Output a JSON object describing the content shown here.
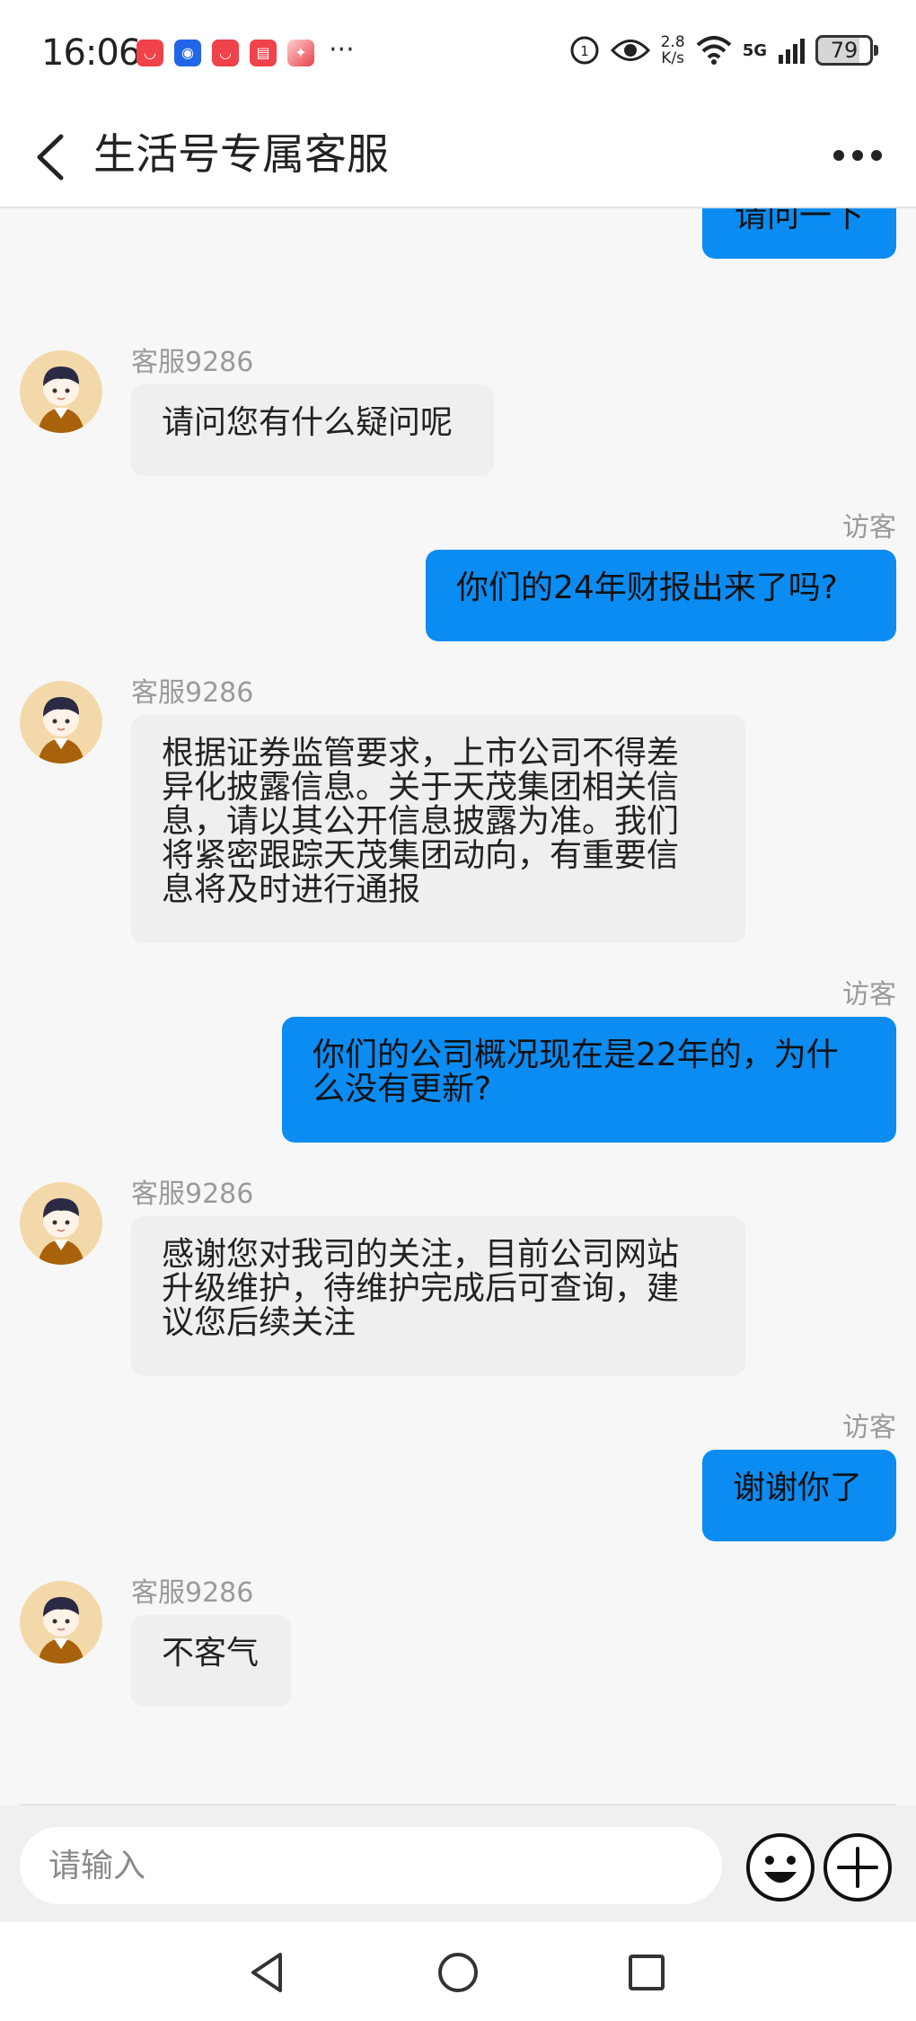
{
  "status_bar": {
    "time": "16:06",
    "more_indicator": "···",
    "net_speed_value": "2.8",
    "net_speed_unit": "K/s",
    "network": "5G",
    "battery": "79"
  },
  "header": {
    "title": "生活号专属客服"
  },
  "chat": {
    "messages": [
      {
        "from": "visitor",
        "text": "请问一下"
      },
      {
        "from": "agent",
        "sender": "客服9286",
        "text": "请问您有什么疑问呢"
      },
      {
        "from": "visitor",
        "sender": "访客",
        "text": "你们的24年财报出来了吗?"
      },
      {
        "from": "agent",
        "sender": "客服9286",
        "lines": [
          "根据证券监管要求，上市公司不得差",
          "异化披露信息。关于天茂集团相关信",
          "息，请以其公开信息披露为准。我们",
          "将紧密跟踪天茂集团动向，有重要信",
          "息将及时进行通报"
        ]
      },
      {
        "from": "visitor",
        "sender": "访客",
        "lines": [
          "你们的公司概况现在是22年的，为什",
          "么没有更新?"
        ]
      },
      {
        "from": "agent",
        "sender": "客服9286",
        "lines": [
          "感谢您对我司的关注，目前公司网站",
          "升级维护，待维护完成后可查询，建",
          "议您后续关注"
        ]
      },
      {
        "from": "visitor",
        "sender": "访客",
        "text": "谢谢你了"
      },
      {
        "from": "agent",
        "sender": "客服9286",
        "text": "不客气"
      }
    ]
  },
  "input": {
    "placeholder": "请输入"
  },
  "colors": {
    "visitor_bubble": "#0a8cf2",
    "agent_bubble": "#efefef",
    "background": "#f7f7f7"
  },
  "icons": {
    "back": "back-arrow-icon",
    "more": "more-dots-icon",
    "emoji": "emoji-icon",
    "plus": "plus-icon"
  }
}
